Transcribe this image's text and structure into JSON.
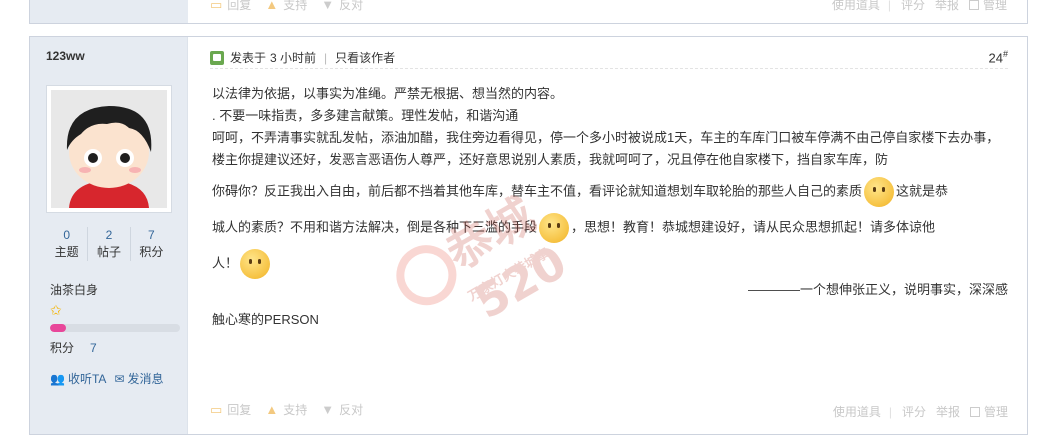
{
  "prev_post": {
    "actions": [
      "回复",
      "支持",
      "反对"
    ],
    "right": [
      "使用道具",
      "评分",
      "举报",
      "管理"
    ]
  },
  "post": {
    "author": "123ww",
    "stats": [
      {
        "num": "0",
        "label": "主题"
      },
      {
        "num": "2",
        "label": "帖子"
      },
      {
        "num": "7",
        "label": "积分"
      }
    ],
    "rank": "油茶白身",
    "level_progress": 0.12,
    "points_label": "积分",
    "points_value": "7",
    "side_actions": {
      "follow": "收听TA",
      "message": "发消息"
    },
    "meta": {
      "posted_prefix": "发表于",
      "posted_time": "3 小时前",
      "only_author": "只看该作者",
      "floor": "24",
      "floor_mark": "#"
    },
    "lines": [
      "以法律为依据，以事实为准绳。严禁无根据、想当然的内容。",
      ". 不要一味指责，多多建言献策。理性发帖，和谐沟通",
      "呵呵，不弄清事实就乱发帖，添油加醋，我住旁边看得见，停一个多小时被说成1天，车主的车库门口被车停满不由己停自家楼下去办事，楼主你提建议还好，发恶言恶语伤人尊严，还好意思说别人素质，我就呵呵了，况且停在他自家楼下，挡自家车库，防",
      "你碍你？反正我出入自由，前后都不挡着其他车库，替车主不值，看评论就知道想划车取轮胎的那些人自己的素质",
      "这就是恭",
      "城人的素质？不用和谐方法解决，倒是各种下三滥的手段",
      "，思想！教育！恭城想建设好，请从民众思想抓起！请多体谅他",
      "人！",
      "————一个想伸张正义，说明事实，深深感",
      "触心寒的PERSON"
    ],
    "actions": [
      "回复",
      "支持",
      "反对"
    ],
    "right": [
      "使用道具",
      "评分",
      "举报",
      "管理"
    ]
  },
  "watermark": {
    "text": "恭城520",
    "sub": "万家灯火恭城事"
  },
  "colors": {
    "sidebar_bg": "#e6ebf2",
    "link": "#336699",
    "progress": "#e8479a",
    "star": "#f5b400"
  },
  "icons": [
    "reply-icon",
    "thumbs-up-icon",
    "thumbs-down-icon",
    "online-icon",
    "star-icon",
    "follow-icon",
    "mail-icon",
    "emoji-icon"
  ]
}
